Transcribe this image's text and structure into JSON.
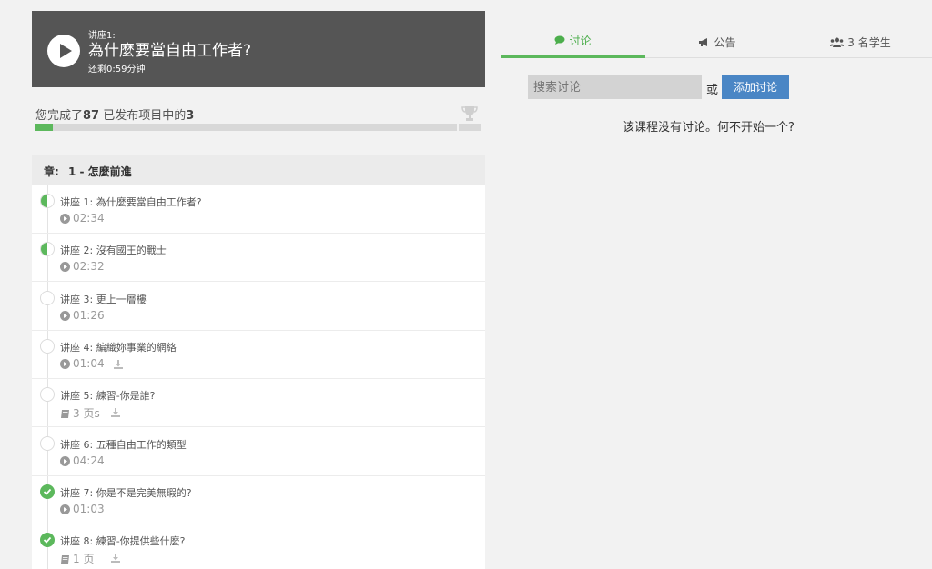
{
  "player": {
    "subtitle": "讲座1:",
    "title": "為什麼要當自由工作者?",
    "time_left": "还剩0:59分钟"
  },
  "progress": {
    "prefix": "您完成了",
    "completed": "87",
    "middle": " 已发布项目中的",
    "total": "3",
    "percent": 4
  },
  "chapter": {
    "label": "章:",
    "title": "1 - 怎麼前進"
  },
  "lectures": [
    {
      "title": "讲座 1: 為什麼要當自由工作者?",
      "meta": "02:34",
      "type": "video",
      "status": "half",
      "download": false
    },
    {
      "title": "讲座 2: 沒有國王的戰士",
      "meta": "02:32",
      "type": "video",
      "status": "half",
      "download": false
    },
    {
      "title": "讲座 3: 更上一層樓",
      "meta": "01:26",
      "type": "video",
      "status": "none",
      "download": false
    },
    {
      "title": "讲座 4: 編織妳事業的網絡",
      "meta": "01:04",
      "type": "video",
      "status": "none",
      "download": true
    },
    {
      "title": "讲座 5: 練習-你是誰?",
      "meta": "3 页s",
      "type": "doc",
      "status": "none",
      "download": true
    },
    {
      "title": "讲座 6: 五種自由工作的類型",
      "meta": "04:24",
      "type": "video",
      "status": "none",
      "download": false
    },
    {
      "title": "讲座 7: 你是不是完美無瑕的?",
      "meta": "01:03",
      "type": "video",
      "status": "done",
      "download": false
    },
    {
      "title": "讲座 8: 練習-你提供些什麼?",
      "meta": "1 页",
      "type": "doc",
      "status": "done",
      "download": true
    }
  ],
  "tabs": [
    {
      "label": "讨论",
      "icon": "comment-icon",
      "active": true
    },
    {
      "label": "公告",
      "icon": "bullhorn-icon",
      "active": false
    },
    {
      "label": "3 名学生",
      "icon": "users-icon",
      "active": false
    }
  ],
  "search": {
    "placeholder": "搜索讨论"
  },
  "or_label": "或",
  "add_button": "添加讨论",
  "empty_message": "该课程没有讨论。何不开始一个?",
  "colors": {
    "accent_green": "#5cb85c",
    "button_blue": "#4a86c5",
    "player_bg": "#555555"
  }
}
